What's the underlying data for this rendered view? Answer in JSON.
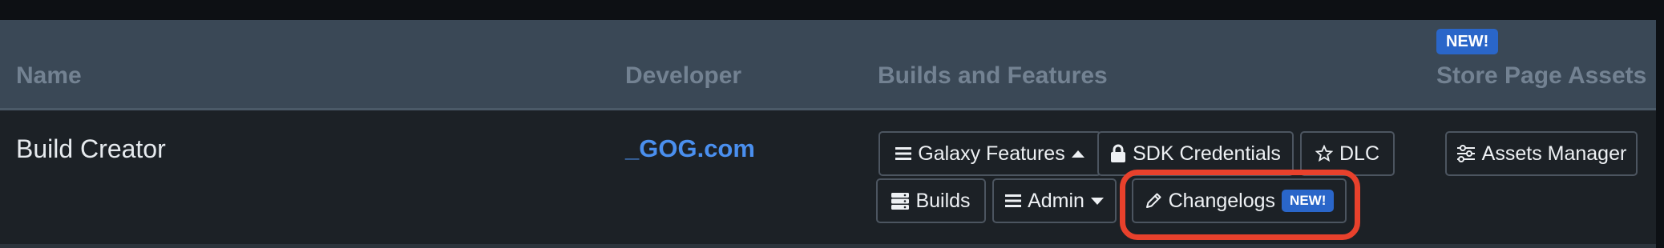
{
  "table": {
    "headers": {
      "name": "Name",
      "developer": "Developer",
      "builds_features": "Builds and Features",
      "store_assets": "Store Page Assets",
      "store_assets_badge": "NEW!"
    },
    "row": {
      "name": "Build Creator",
      "developer": "_GOG.com",
      "buttons": {
        "galaxy_features": "Galaxy Features",
        "sdk_credentials": "SDK Credentials",
        "dlc": "DLC",
        "builds": "Builds",
        "admin": "Admin",
        "changelogs": "Changelogs",
        "changelogs_badge": "NEW!",
        "assets_manager": "Assets Manager"
      }
    }
  },
  "icons": {
    "galaxy_features": "list-icon",
    "galaxy_features_caret": "caret-up-icon",
    "sdk_credentials": "lock-icon",
    "dlc": "star-outline-icon",
    "builds": "server-icon",
    "admin": "list-icon",
    "admin_caret": "caret-down-icon",
    "changelogs": "pencil-icon",
    "assets_manager": "sliders-icon"
  },
  "colors": {
    "header_bg": "#3a4856",
    "header_text": "#738292",
    "row_bg": "#1c2126",
    "link": "#4a8fee",
    "badge": "#2a66c9",
    "highlight": "#e8412c"
  }
}
